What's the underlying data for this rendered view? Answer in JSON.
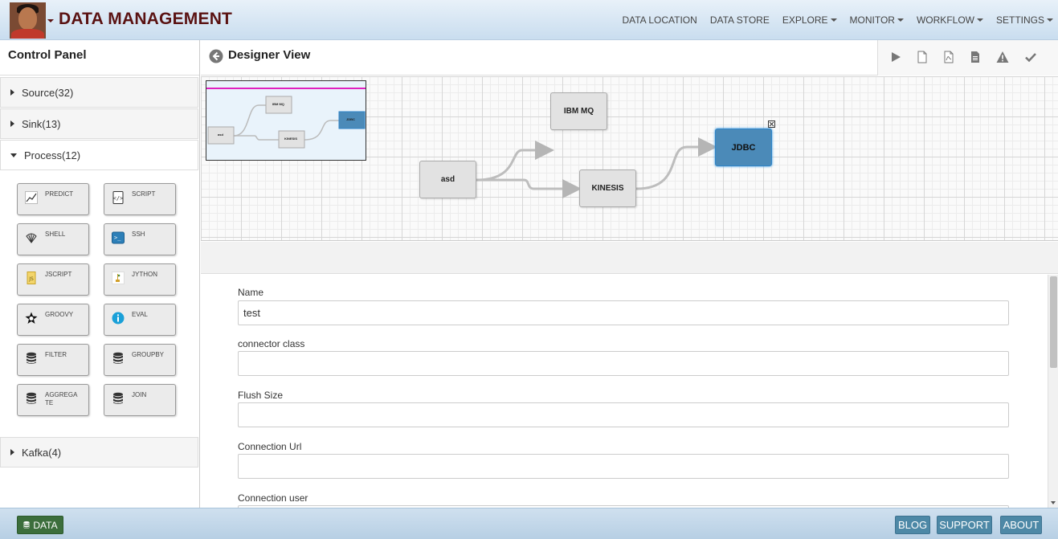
{
  "header": {
    "app_title": "DATA MANAGEMENT",
    "nav": [
      {
        "label": "DATA LOCATION",
        "dropdown": false
      },
      {
        "label": "DATA STORE",
        "dropdown": false
      },
      {
        "label": "EXPLORE",
        "dropdown": true
      },
      {
        "label": "MONITOR",
        "dropdown": true
      },
      {
        "label": "WORKFLOW",
        "dropdown": true
      },
      {
        "label": "SETTINGS",
        "dropdown": true
      }
    ]
  },
  "sidebar": {
    "title": "Control Panel",
    "sections": [
      {
        "label": "Source(32)",
        "expanded": false
      },
      {
        "label": "Sink(13)",
        "expanded": false
      },
      {
        "label": "Process(12)",
        "expanded": true
      },
      {
        "label": "Kafka(4)",
        "expanded": false
      }
    ],
    "process_tools": [
      {
        "label": "PREDICT",
        "icon": "chart-line-icon"
      },
      {
        "label": "SCRIPT",
        "icon": "script-file-icon"
      },
      {
        "label": "SHELL",
        "icon": "shell-icon"
      },
      {
        "label": "SSH",
        "icon": "terminal-icon"
      },
      {
        "label": "JSCRIPT",
        "icon": "javascript-icon"
      },
      {
        "label": "JYTHON",
        "icon": "jython-icon"
      },
      {
        "label": "GROOVY",
        "icon": "groovy-star-icon"
      },
      {
        "label": "EVAL",
        "icon": "info-circle-icon"
      },
      {
        "label": "FILTER",
        "icon": "database-icon"
      },
      {
        "label": "GROUPBY",
        "icon": "database-icon"
      },
      {
        "label": "AGGREGATE",
        "icon": "database-icon"
      },
      {
        "label": "JOIN",
        "icon": "database-icon"
      }
    ]
  },
  "designer": {
    "title": "Designer View",
    "toolbar_icons": [
      "play-icon",
      "file-icon",
      "pdf-file-icon",
      "document-icon",
      "warning-icon",
      "check-icon"
    ],
    "nodes": [
      {
        "id": "asd",
        "label": "asd"
      },
      {
        "id": "ibmmq",
        "label": "IBM MQ"
      },
      {
        "id": "kinesis",
        "label": "KINESIS"
      },
      {
        "id": "jdbc",
        "label": "JDBC",
        "selected": true
      }
    ],
    "accent_selected": "#4b8ab8",
    "minimap_highlight": "#e020c0"
  },
  "form": {
    "fields": [
      {
        "label": "Name",
        "value": "test"
      },
      {
        "label": "connector class",
        "value": ""
      },
      {
        "label": "Flush Size",
        "value": ""
      },
      {
        "label": "Connection Url",
        "value": ""
      },
      {
        "label": "Connection user",
        "value": ""
      }
    ]
  },
  "footer": {
    "data_button": "DATA",
    "buttons": [
      "BLOG",
      "SUPPORT",
      "ABOUT"
    ]
  }
}
